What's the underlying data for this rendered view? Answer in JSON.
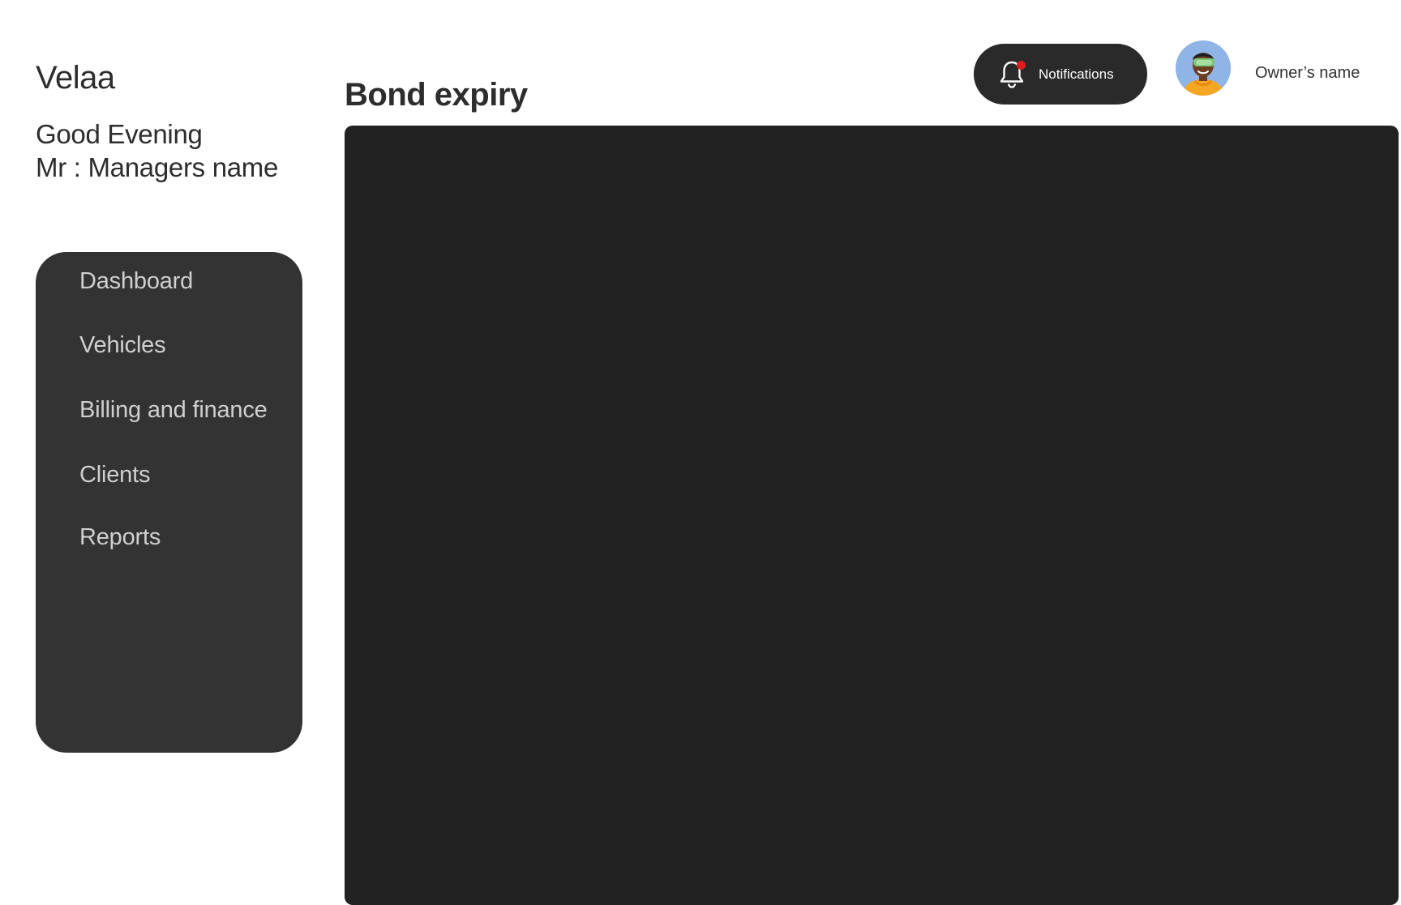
{
  "brand": {
    "name": "Velaa"
  },
  "greeting": {
    "line1": "Good Evening",
    "line2": "Mr : Managers name"
  },
  "sidebar": {
    "items": [
      {
        "label": "Dashboard"
      },
      {
        "label": "Vehicles"
      },
      {
        "label": "Billing and finance"
      },
      {
        "label": "Clients"
      },
      {
        "label": "Reports"
      }
    ]
  },
  "main": {
    "title": "Bond expiry"
  },
  "header": {
    "notifications_label": "Notifications",
    "notifications_icon": "bell-icon",
    "has_unread": true,
    "owner_name": "Owner’s name"
  },
  "colors": {
    "sidebar_bg": "#333333",
    "panel_bg": "#222222",
    "notif_bg": "#2a2a2a",
    "unread_dot": "#e01b1b"
  }
}
